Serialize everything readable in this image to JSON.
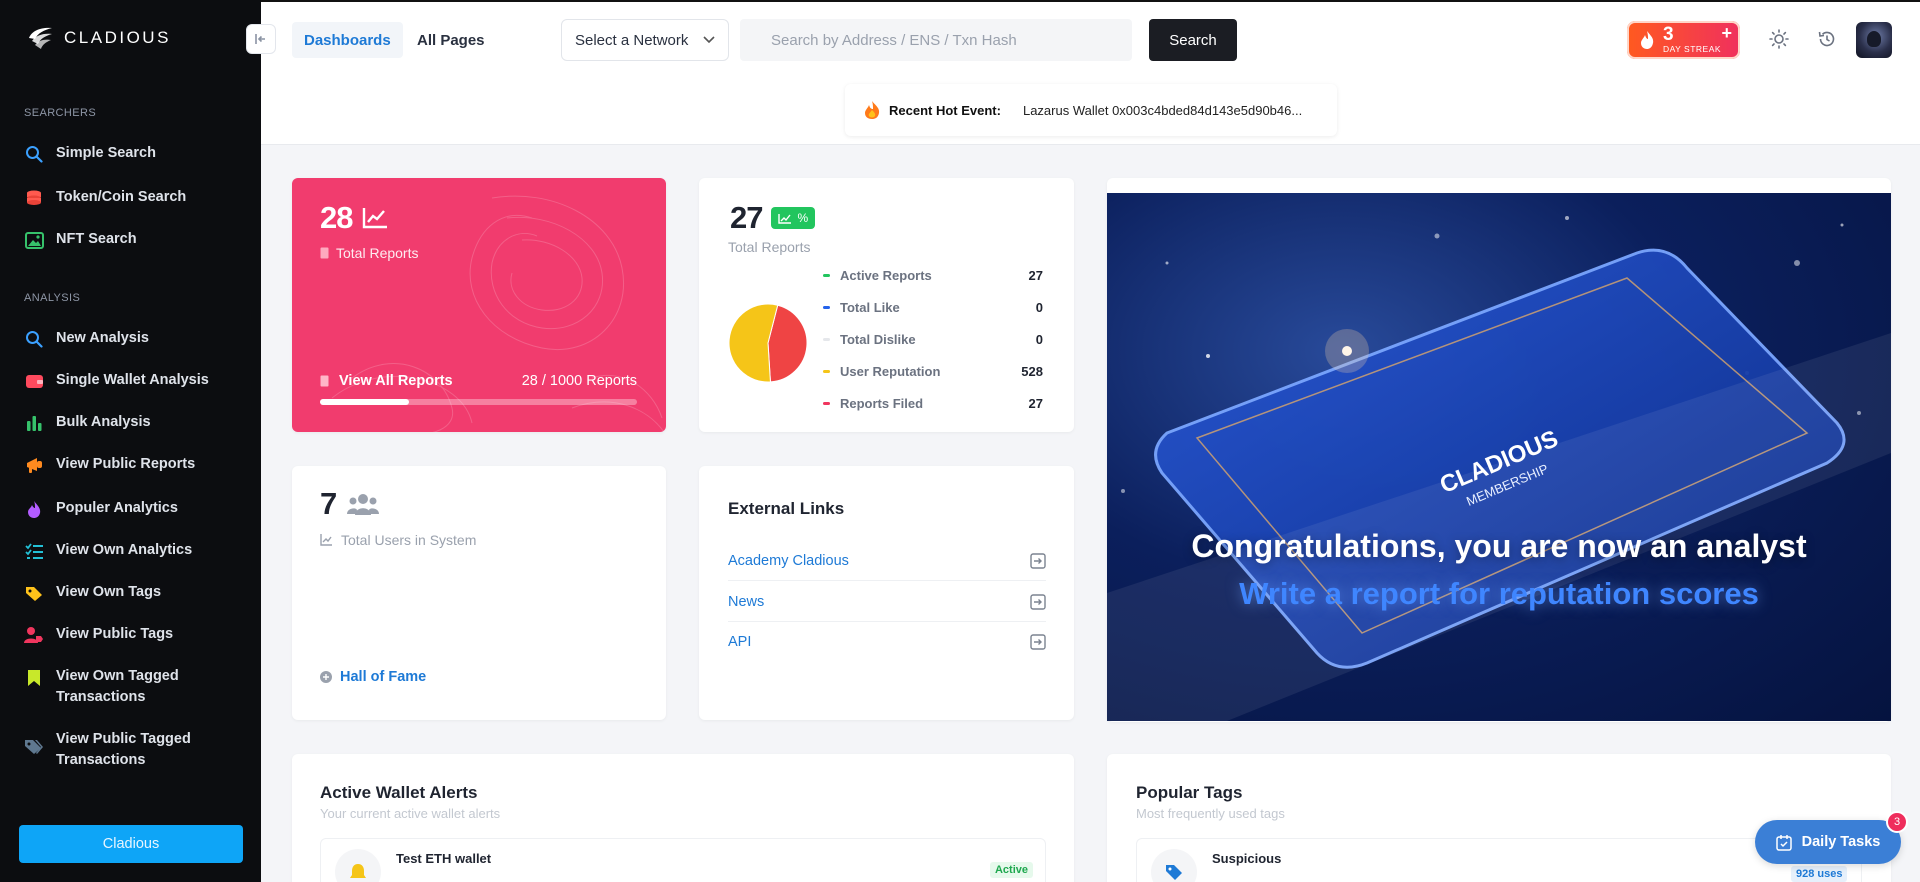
{
  "brand": {
    "name": "CLADIOUS"
  },
  "sidebar": {
    "sections": [
      {
        "title": "SEARCHERS",
        "items": [
          {
            "label": "Simple Search",
            "icon": "search-icon",
            "color": "#3ba0ff"
          },
          {
            "label": "Token/Coin Search",
            "icon": "coins-icon",
            "color": "#ff5a4f"
          },
          {
            "label": "NFT Search",
            "icon": "image-icon",
            "color": "#36c26b"
          }
        ]
      },
      {
        "title": "ANALYSIS",
        "items": [
          {
            "label": "New Analysis",
            "icon": "search-icon",
            "color": "#3ba0ff"
          },
          {
            "label": "Single Wallet Analysis",
            "icon": "wallet-icon",
            "color": "#ff4a5e"
          },
          {
            "label": "Bulk Analysis",
            "icon": "bar-chart-icon",
            "color": "#36c26b"
          },
          {
            "label": "View Public Reports",
            "icon": "megaphone-icon",
            "color": "#ff8a1f"
          },
          {
            "label": "Populer Analytics",
            "icon": "fire-icon",
            "color": "#b35cff"
          },
          {
            "label": "View Own Analytics",
            "icon": "list-check-icon",
            "color": "#23c0d6"
          },
          {
            "label": "View Own Tags",
            "icon": "tags-icon",
            "color": "#ffc21a"
          },
          {
            "label": "View Public Tags",
            "icon": "users-tag-icon",
            "color": "#f0365e"
          },
          {
            "label": "View Own Tagged Transactions",
            "icon": "bookmark-icon",
            "color": "#c8e82a"
          },
          {
            "label": "View Public Tagged Transactions",
            "icon": "tags-icon",
            "color": "#5f7890"
          }
        ]
      }
    ],
    "footer_button": "Cladious"
  },
  "header": {
    "tabs": [
      {
        "label": "Dashboards",
        "active": true
      },
      {
        "label": "All Pages",
        "active": false
      }
    ],
    "network_select": "Select a Network",
    "search_placeholder": "Search by Address / ENS / Txn Hash",
    "search_button": "Search",
    "streak": {
      "count": "3",
      "label": "DAY STREAK"
    }
  },
  "hot_event": {
    "label": "Recent Hot Event:",
    "value": "Lazarus Wallet 0x003c4bded84d143e5d90b46..."
  },
  "reports_card": {
    "count": "28",
    "label": "Total Reports",
    "link": "View All Reports",
    "progress_text": "28 / 1000 Reports",
    "progress": 0.028
  },
  "stats_card": {
    "count": "27",
    "badge": "%",
    "label": "Total Reports",
    "legend": [
      {
        "label": "Active Reports",
        "value": "27",
        "color": "#22c55e"
      },
      {
        "label": "Total Like",
        "value": "0",
        "color": "#2563eb"
      },
      {
        "label": "Total Dislike",
        "value": "0",
        "color": "#e5e7eb"
      },
      {
        "label": "User Reputation",
        "value": "528",
        "color": "#f5c518"
      },
      {
        "label": "Reports Filed",
        "value": "27",
        "color": "#f0365e"
      }
    ],
    "pie": [
      {
        "name": "Active Reports",
        "value": 27,
        "color": "#ef4444"
      },
      {
        "name": "User Reputation",
        "value": 33,
        "color": "#f5c518"
      }
    ]
  },
  "users_card": {
    "count": "7",
    "label": "Total Users in System",
    "link": "Hall of Fame"
  },
  "external_links": {
    "title": "External Links",
    "items": [
      "Academy Cladious",
      "News",
      "API"
    ]
  },
  "banner": {
    "card_text_1": "CLADIOUS",
    "card_text_2": "MEMBERSHIP",
    "title": "Congratulations, you are now an analyst",
    "subtitle": "Write a report for reputation scores"
  },
  "alerts": {
    "title": "Active Wallet Alerts",
    "subtitle": "Your current active wallet alerts",
    "item_name": "Test ETH wallet",
    "item_status": "Active"
  },
  "popular_tags": {
    "title": "Popular Tags",
    "subtitle": "Most frequently used tags",
    "item_name": "Suspicious",
    "item_uses": "928 uses"
  },
  "daily_tasks": {
    "label": "Daily Tasks",
    "count": "3"
  }
}
